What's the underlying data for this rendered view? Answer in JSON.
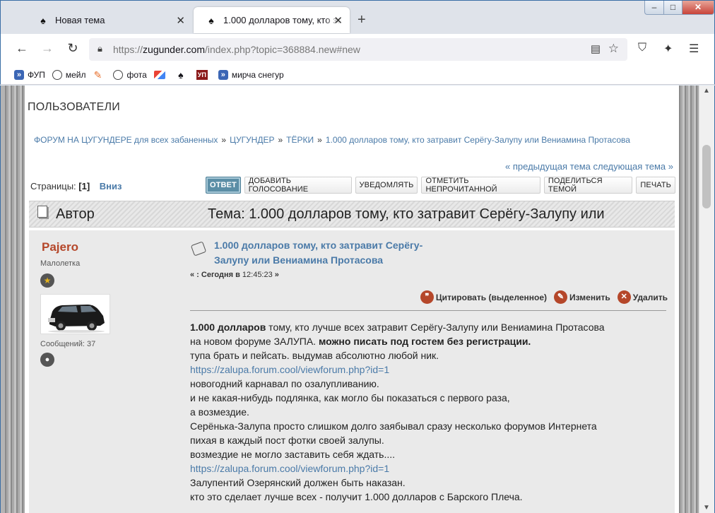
{
  "browser": {
    "tabs": [
      {
        "label": "Новая тема",
        "active": false
      },
      {
        "label": "1.000 долларов тому, кто затравит Серёгу-Залупу или Вениамина Протасова",
        "active": true
      }
    ],
    "url_prefix": "https://",
    "url_host": "zugunder.com",
    "url_path": "/index.php?topic=368884.new#new",
    "bookmarks": [
      {
        "label": "ФУП",
        "icon": "chevron-icon"
      },
      {
        "label": "мейл",
        "icon": "globe-icon"
      },
      {
        "label": "",
        "icon": "pen-icon"
      },
      {
        "label": "фота",
        "icon": "globe-icon"
      },
      {
        "label": "",
        "icon": "mail-icon"
      },
      {
        "label": "",
        "icon": "spade-icon"
      },
      {
        "label": "УП",
        "icon": "up-icon"
      },
      {
        "label": "мирча снегур",
        "icon": "chevron-icon"
      }
    ]
  },
  "page": {
    "section_title": "ПОЛЬЗОВАТЕЛИ",
    "breadcrumb": [
      "ФОРУМ НА ЦУГУНДЕРЕ для всех забаненных",
      "ЦУГУНДЕР",
      "ТЁРКИ",
      "1.000 долларов тому, кто затравит Серёгу-Залупу или Вениамина Протасова"
    ],
    "breadcrumb_sep": "»",
    "prev_next": "« предыдущая тема следующая тема »",
    "pages_label": "Страницы:",
    "pages_current": "[1]",
    "down_link": "Вниз",
    "buttons": [
      "ОТВЕТ",
      "ДОБАВИТЬ ГОЛОСОВАНИЕ",
      "УВЕДОМЛЯТЬ",
      "ОТМЕТИТЬ НЕПРОЧИТАННОЙ",
      "ПОДЕЛИТЬСЯ ТЕМОЙ",
      "ПЕЧАТЬ"
    ],
    "header_author": "Автор",
    "header_topic": "Тема: 1.000 долларов тому, кто затравит Серёгу-Залупу или"
  },
  "post": {
    "poster_name": "Pajero",
    "poster_rank": "Малолетка",
    "messages": "Сообщений: 37",
    "subject": "1.000 долларов тому, кто затравит Серёгу-Залупу или Вениамина Протасова",
    "date_prefix": "« : Сегодня в",
    "date_time": "12:45:23",
    "date_suffix": "»",
    "actions": [
      "Цитировать (выделенное)",
      "Изменить",
      "Удалить"
    ],
    "body": {
      "l1_bold": "1.000 долларов",
      "l1_rest": " тому, кто лучше всех затравит Серёгу-Залупу или Вениамина Протасова",
      "l2_plain": "на новом форуме ЗАЛУПА. ",
      "l2_bold": "можно писать под гостем без регистрации.",
      "l3": "тупа брать и пейсать. выдумав абсолютно любой ник.",
      "link1": "https://zalupa.forum.cool/viewforum.php?id=1",
      "l5": "новогодний карнавал по озалупливанию.",
      "l6": "и не какая-нибудь подлянка, как могло бы показаться с первого раза,",
      "l7": "а возмездие.",
      "l8": "Серёнька-Залупа просто слишком долго заябывал сразу несколько форумов Интернета",
      "l9": "пихая в каждый пост фотки своей залупы.",
      "l10": "возмездие не могло заставить себя ждать....",
      "link2": "https://zalupa.forum.cool/viewforum.php?id=1",
      "l12": "Залупентий Озерянский должен быть наказан.",
      "l13": "кто это сделает лучше всех - получит 1.000 долларов с Барского Плеча."
    }
  }
}
